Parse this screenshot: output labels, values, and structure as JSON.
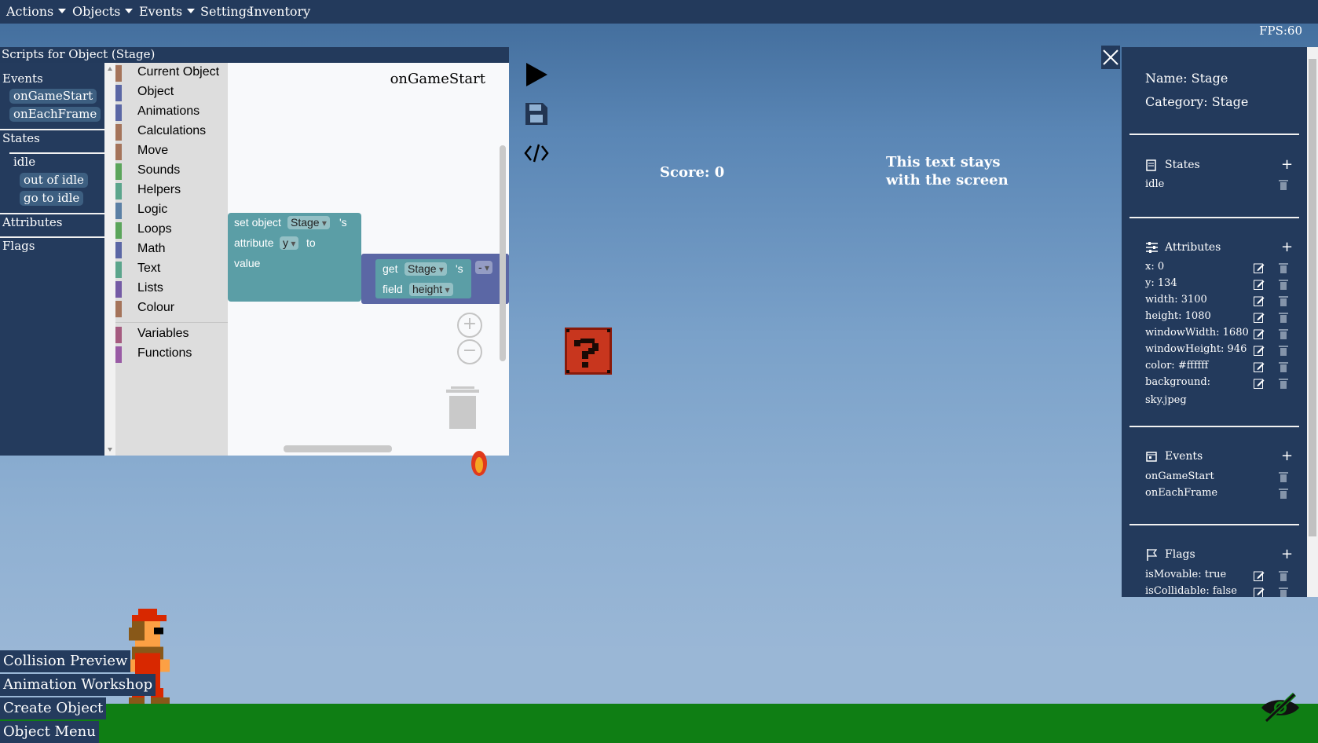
{
  "menu": {
    "items": [
      {
        "label": "Actions",
        "dropdown": true
      },
      {
        "label": "Objects",
        "dropdown": true
      },
      {
        "label": "Events",
        "dropdown": true
      },
      {
        "label": "Settings",
        "dropdown": false
      },
      {
        "label": "Inventory",
        "dropdown": false
      }
    ]
  },
  "fps": "FPS:60",
  "script_editor": {
    "title": "Scripts for Object (Stage)",
    "tree": {
      "events_header": "Events",
      "events": [
        "onGameStart",
        "onEachFrame"
      ],
      "states_header": "States",
      "state": "idle",
      "state_transitions": [
        "out of idle",
        "go to idle"
      ],
      "attributes_header": "Attributes",
      "flags_header": "Flags"
    },
    "categories": [
      {
        "label": "Current Object",
        "color": "#a5745b"
      },
      {
        "label": "Object",
        "color": "#5b67a5"
      },
      {
        "label": "Animations",
        "color": "#5b67a5"
      },
      {
        "label": "Calculations",
        "color": "#a5745b"
      },
      {
        "label": "Move",
        "color": "#a5745b"
      },
      {
        "label": "Sounds",
        "color": "#5ba55b"
      },
      {
        "label": "Helpers",
        "color": "#5ba58c"
      },
      {
        "label": "Logic",
        "color": "#5b80a5"
      },
      {
        "label": "Loops",
        "color": "#5ba55b"
      },
      {
        "label": "Math",
        "color": "#5b67a5"
      },
      {
        "label": "Text",
        "color": "#5ba58c"
      },
      {
        "label": "Lists",
        "color": "#745ba5"
      },
      {
        "label": "Colour",
        "color": "#a5745b"
      },
      {
        "label": "Variables",
        "color": "#a55b80"
      },
      {
        "label": "Functions",
        "color": "#995ba5"
      }
    ],
    "workspace_title": "onGameStart",
    "set_block": {
      "set_object": "set object",
      "object_value": "Stage",
      "possessive": "'s",
      "attribute": "attribute",
      "attribute_value": "y",
      "to": "to",
      "value": "value"
    },
    "get_block": {
      "get": "get",
      "object_value": "Stage",
      "possessive": "'s",
      "field": "field",
      "field_value": "height",
      "operator": "-"
    },
    "zoom_in": "+",
    "zoom_out": "−"
  },
  "tools": {
    "play": "play-icon",
    "save": "save-icon",
    "code": "code-icon"
  },
  "game": {
    "score": "Score: 0",
    "sticky_line1": "This text stays",
    "sticky_line2": "with the screen"
  },
  "properties": {
    "name": "Name: Stage",
    "category": "Category: Stage",
    "states_header": "States",
    "states": [
      "idle"
    ],
    "attributes_header": "Attributes",
    "attributes": [
      "x: 0",
      "y: 134",
      "width: 3100",
      "height: 1080",
      "windowWidth: 1680",
      "windowHeight: 946",
      "color: #ffffff",
      "background:"
    ],
    "background_value": "sky.jpeg",
    "events_header": "Events",
    "events": [
      "onGameStart",
      "onEachFrame"
    ],
    "flags_header": "Flags",
    "flags": [
      "isMovable: true",
      "isCollidable: false"
    ]
  },
  "bottom_menu": [
    "Collision Preview",
    "Animation Workshop",
    "Create Object",
    "Object Menu"
  ],
  "colors": {
    "panel": "#233a5c",
    "ground": "#0f7e14",
    "set_block": "#5b9ea6",
    "get_block": "#5b67a5"
  }
}
